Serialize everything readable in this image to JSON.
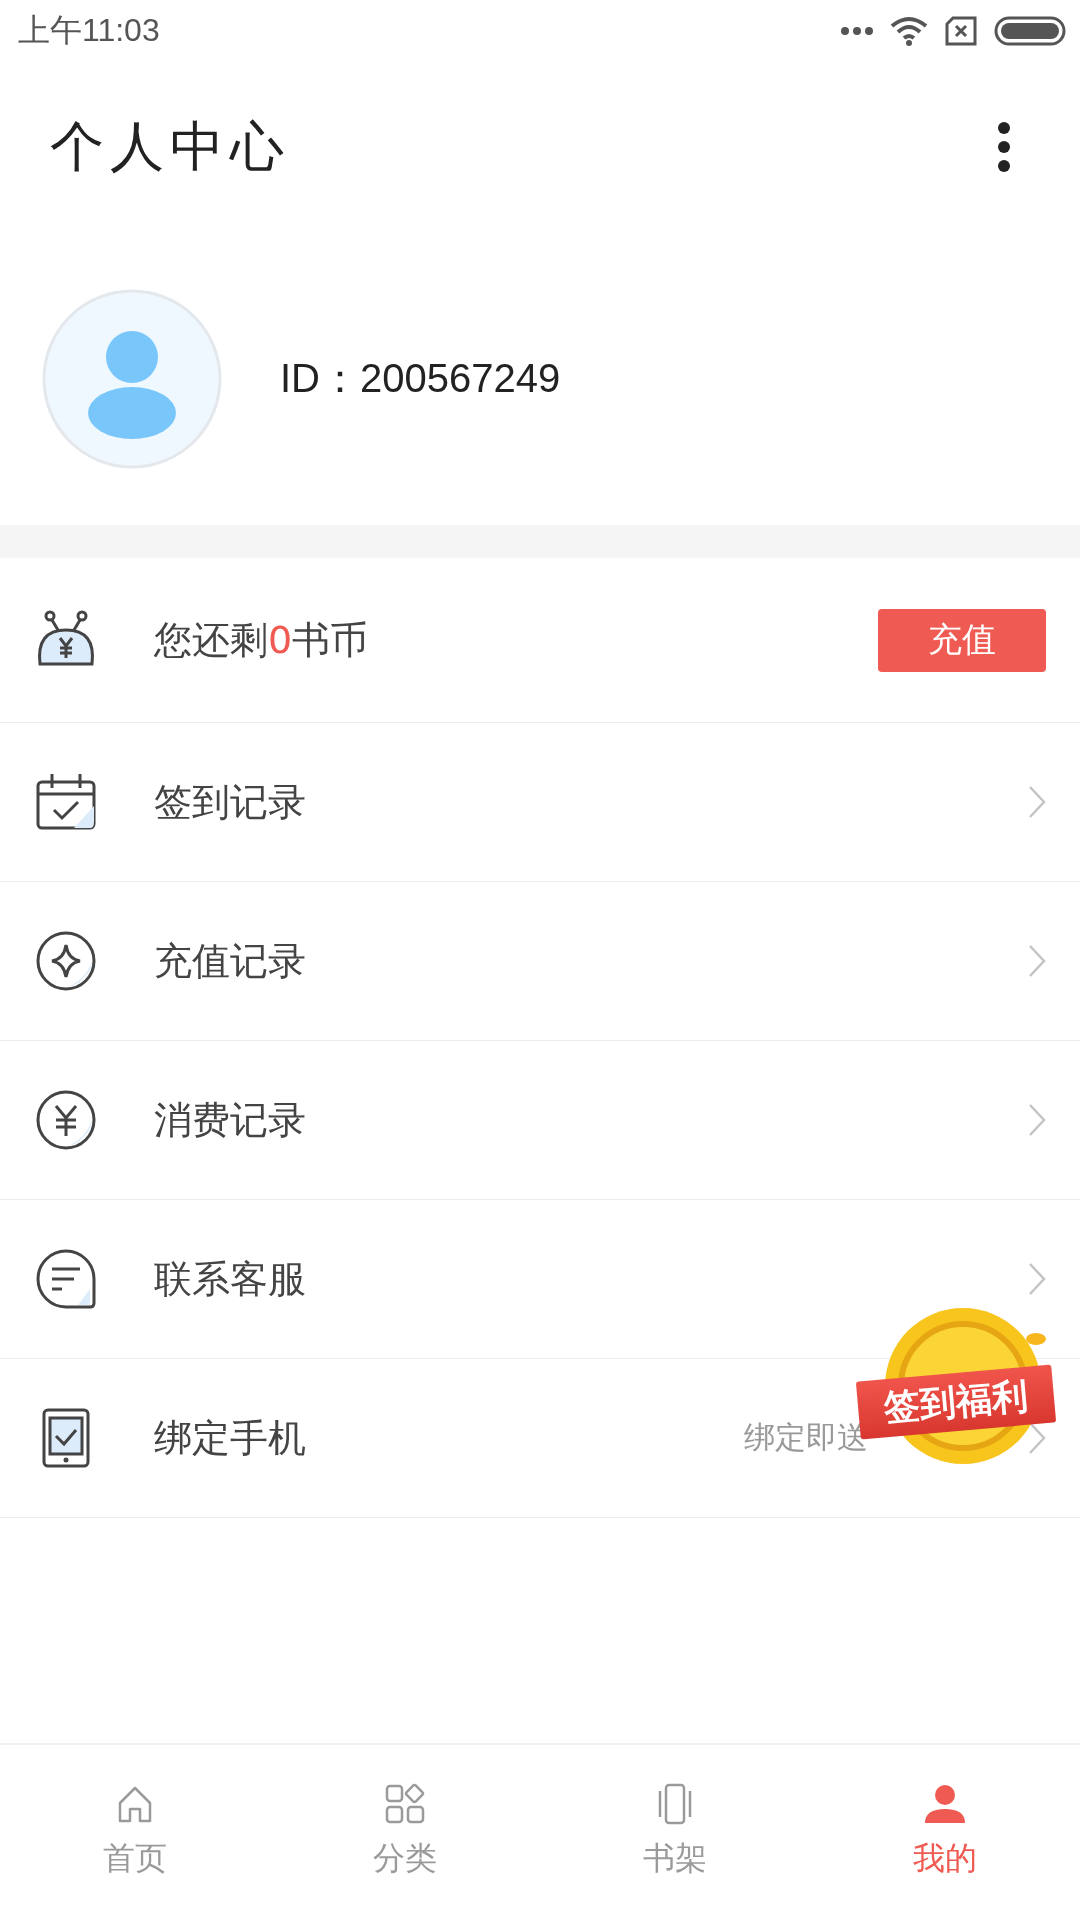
{
  "status_bar": {
    "time": "上午11:03"
  },
  "header": {
    "title": "个人中心"
  },
  "profile": {
    "id_text": "ID：200567249"
  },
  "menu": [
    {
      "kind": "balance",
      "prefix": "您还剩",
      "amount": "0",
      "suffix": "书币",
      "button": "充值"
    },
    {
      "kind": "link",
      "label": "签到记录"
    },
    {
      "kind": "link",
      "label": "充值记录"
    },
    {
      "kind": "link",
      "label": "消费记录"
    },
    {
      "kind": "link",
      "label": "联系客服"
    },
    {
      "kind": "link",
      "label": "绑定手机",
      "hint": "绑定即送"
    }
  ],
  "promo_badge": {
    "label": "签到福利"
  },
  "tabs": [
    {
      "label": "首页",
      "selected": false
    },
    {
      "label": "分类",
      "selected": false
    },
    {
      "label": "书架",
      "selected": false
    },
    {
      "label": "我的",
      "selected": true
    }
  ]
}
